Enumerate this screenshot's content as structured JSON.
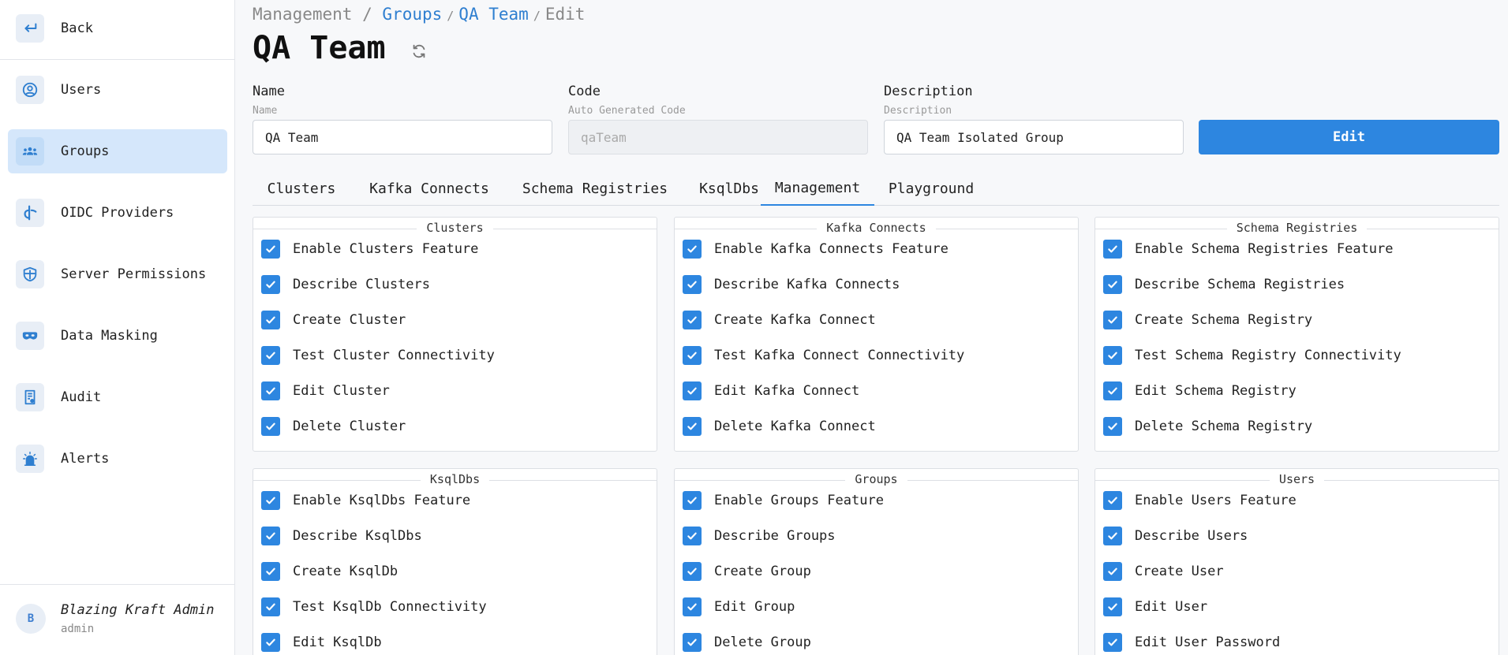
{
  "sidebar": {
    "back": {
      "label": "Back",
      "icon": "back-arrow-icon"
    },
    "items": [
      {
        "label": "Users",
        "icon": "user-circle-icon"
      },
      {
        "label": "Groups",
        "icon": "groups-icon",
        "active": true
      },
      {
        "label": "OIDC Providers",
        "icon": "oidc-icon"
      },
      {
        "label": "Server Permissions",
        "icon": "shield-icon"
      },
      {
        "label": "Data Masking",
        "icon": "mask-icon"
      },
      {
        "label": "Audit",
        "icon": "audit-icon"
      },
      {
        "label": "Alerts",
        "icon": "alarm-icon"
      }
    ],
    "user": {
      "initial": "B",
      "name": "Blazing Kraft Admin",
      "role": "admin"
    }
  },
  "breadcrumb": {
    "root": "Management",
    "sep": "/",
    "groups": "Groups",
    "team": "QA Team",
    "current": "Edit"
  },
  "page_title": "QA Team",
  "form": {
    "name": {
      "label": "Name",
      "sublabel": "Name",
      "value": "QA Team"
    },
    "code": {
      "label": "Code",
      "sublabel": "Auto Generated Code",
      "value": "qaTeam"
    },
    "description": {
      "label": "Description",
      "sublabel": "Description",
      "value": "QA Team Isolated Group"
    },
    "edit_label": "Edit"
  },
  "tabs": [
    "Clusters",
    "Kafka Connects",
    "Schema Registries",
    "KsqlDbs",
    "Management",
    "Playground"
  ],
  "active_tab": "Management",
  "panels": [
    {
      "title": "Clusters",
      "items": [
        "Enable Clusters Feature",
        "Describe Clusters",
        "Create Cluster",
        "Test Cluster Connectivity",
        "Edit Cluster",
        "Delete Cluster"
      ]
    },
    {
      "title": "Kafka Connects",
      "items": [
        "Enable Kafka Connects Feature",
        "Describe Kafka Connects",
        "Create Kafka Connect",
        "Test Kafka Connect Connectivity",
        "Edit Kafka Connect",
        "Delete Kafka Connect"
      ]
    },
    {
      "title": "Schema Registries",
      "items": [
        "Enable Schema Registries Feature",
        "Describe Schema Registries",
        "Create Schema Registry",
        "Test Schema Registry Connectivity",
        "Edit Schema Registry",
        "Delete Schema Registry"
      ]
    },
    {
      "title": "KsqlDbs",
      "items": [
        "Enable KsqlDbs Feature",
        "Describe KsqlDbs",
        "Create KsqlDb",
        "Test KsqlDb Connectivity",
        "Edit KsqlDb"
      ]
    },
    {
      "title": "Groups",
      "items": [
        "Enable Groups Feature",
        "Describe Groups",
        "Create Group",
        "Edit Group",
        "Delete Group"
      ]
    },
    {
      "title": "Users",
      "items": [
        "Enable Users Feature",
        "Describe Users",
        "Create User",
        "Edit User",
        "Edit User Password"
      ]
    }
  ],
  "colors": {
    "accent": "#2d86e0",
    "active_nav_bg": "#d5e7fb",
    "link": "#2f7fd0"
  }
}
